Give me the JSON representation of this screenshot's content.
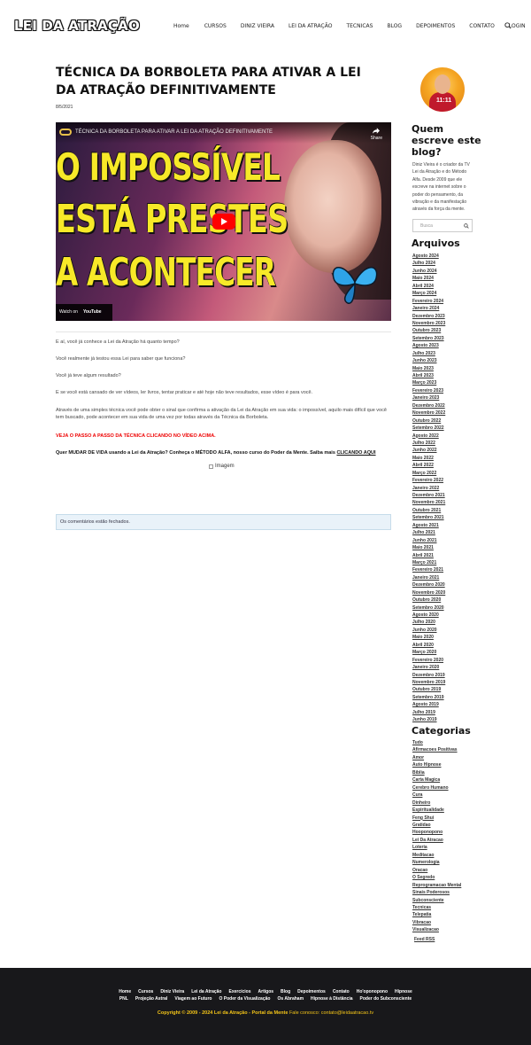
{
  "header": {
    "logo": "LEI DA ATRAÇÃO",
    "nav": [
      "Home",
      "CURSOS",
      "DINIZ VIEIRA",
      "LEI DA ATRAÇÃO",
      "TECNICAS",
      "BLOG",
      "DEPOIMENTOS",
      "CONTATO",
      "LOGIN"
    ],
    "search_icon": "search-icon"
  },
  "post": {
    "title": "TÉCNICA DA BORBOLETA PARA ATIVAR A LEI DA ATRAÇÃO DEFINITIVAMENTE",
    "date": "8/5/2021",
    "video": {
      "title": "TÉCNICA DA BORBOLETA PARA ATIVAR A LEI DA ATRAÇÃO DEFINITIVAMENTE",
      "share": "Share",
      "line1": "O IMPOSSÍVEL",
      "line2": "ESTÁ PRESTES",
      "line3": "A ACONTECER",
      "watch_on": "Watch on",
      "youtube": "YouTube"
    },
    "paragraphs": [
      "E aí, você já conhece a Lei da Atração há quanto tempo?",
      "Você realmente já testou essa Lei para saber que funciona?",
      "Você já teve algum resultado?",
      "E se você está cansado de ver vídeos, ler livros, tentar praticar e até hoje não teve resultados, esse vídeo é para você.",
      "Através de uma simples técnica você pode obter o sinal que confirma a ativação da Lei da Atração em sua vida: o impossível, aquilo mais difícil que você tem buscado, pode acontecer em sua vida de uma vez por todas através da Técnica da Borboleta."
    ],
    "red_note": "VEJA O PASSO A PASSO DA TÉCNICA CLICANDO NO VÍDEO ACIMA.",
    "cta_text": "Quer MUDAR DE VIDA usando a Lei da Atração? Conheça o MÉTODO ALFA, nosso curso do Poder da Mente. Saiba mais",
    "cta_link": "CLICANDO AQUI",
    "image_alt": "Imagem",
    "comments_closed": "Os comentários estão fechados."
  },
  "sidebar": {
    "about_title": "Quem escreve este blog?",
    "about_text": "Diniz Vieira é o criador da TV Lei da Atração e do Método Alfa. Desde 2009 que ele escreve na internet sobre o poder do pensamento, da vibração e da manifestação através da força da mente.",
    "avatar_text": "11:11",
    "search_placeholder": "Busca",
    "archives_title": "Arquivos",
    "archives": [
      "Agosto 2024",
      "Julho 2024",
      "Junho 2024",
      "Maio 2024",
      "Abril 2024",
      "Março 2024",
      "Fevereiro 2024",
      "Janeiro 2024",
      "Dezembro 2023",
      "Novembro 2023",
      "Outubro 2023",
      "Setembro 2023",
      "Agosto 2023",
      "Julho 2023",
      "Junho 2023",
      "Maio 2023",
      "Abril 2023",
      "Março 2023",
      "Fevereiro 2023",
      "Janeiro 2023",
      "Dezembro 2022",
      "Novembro 2022",
      "Outubro 2022",
      "Setembro 2022",
      "Agosto 2022",
      "Julho 2022",
      "Junho 2022",
      "Maio 2022",
      "Abril 2022",
      "Março 2022",
      "Fevereiro 2022",
      "Janeiro 2022",
      "Dezembro 2021",
      "Novembro 2021",
      "Outubro 2021",
      "Setembro 2021",
      "Agosto 2021",
      "Julho 2021",
      "Junho 2021",
      "Maio 2021",
      "Abril 2021",
      "Março 2021",
      "Fevereiro 2021",
      "Janeiro 2021",
      "Dezembro 2020",
      "Novembro 2020",
      "Outubro 2020",
      "Setembro 2020",
      "Agosto 2020",
      "Julho 2020",
      "Junho 2020",
      "Maio 2020",
      "Abril 2020",
      "Março 2020",
      "Fevereiro 2020",
      "Janeiro 2020",
      "Dezembro 2019",
      "Novembro 2019",
      "Outubro 2019",
      "Setembro 2019",
      "Agosto 2019",
      "Julho 2019",
      "Junho 2019"
    ],
    "categories_title": "Categorias",
    "categories": [
      "Tudo",
      "Afirmacoes Positivas",
      "Amor",
      "Auto Hipnose",
      "Biblia",
      "Carta Magica",
      "Cerebro Humano",
      "Cura",
      "Dinheiro",
      "Espiritualidade",
      "Feng Shui",
      "Gratidao",
      "Hooponopono",
      "Lei Da Atracao",
      "Loteria",
      "Meditacao",
      "Numerologia",
      "Oracao",
      "O Segredo",
      "Reprogramacao Mental",
      "Sinais Poderosos",
      "Subconsciente",
      "Tecnicas",
      "Telepatia",
      "Vibracao",
      "Visualizacao"
    ],
    "feed": "Feed RSS"
  },
  "footer": {
    "row1": [
      "Home",
      "Cursos",
      "Diniz Vieira",
      "Lei da Atração",
      "Exercícios",
      "Artigos",
      "Blog",
      "Depoimentos",
      "Contato",
      "Ho'oponopono",
      "Hipnose"
    ],
    "row2": [
      "PNL",
      "Projeção Astral",
      "Viagem ao Futuro",
      "O Poder da Visualização",
      "Os Abraham",
      "Hipnose à Distância",
      "Poder do Subconsciente"
    ],
    "copyright": "Copyright © 2009 - 2024 Lei da Atração - Portal da Mente",
    "contact": "Fale conosco: contato@leidaatracao.tv"
  },
  "colors": {
    "accent_yellow": "#f5c518",
    "red_text": "#e00000",
    "footer_bg": "#18181b"
  }
}
